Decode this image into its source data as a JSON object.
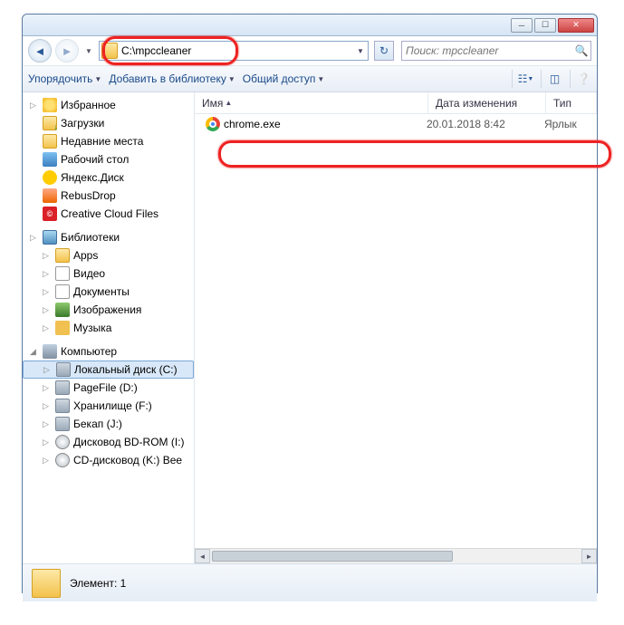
{
  "address": {
    "path": "C:\\mpccleaner"
  },
  "search": {
    "placeholder": "Поиск: mpccleaner"
  },
  "toolbar": {
    "organize": "Упорядочить",
    "add_library": "Добавить в библиотеку",
    "share": "Общий доступ"
  },
  "columns": {
    "name": "Имя",
    "date": "Дата изменения",
    "type": "Тип"
  },
  "sidebar": {
    "favorites": "Избранное",
    "items_fav": [
      "Загрузки",
      "Недавние места",
      "Рабочий стол",
      "Яндекс.Диск",
      "RebusDrop",
      "Creative Cloud Files"
    ],
    "libraries": "Библиотеки",
    "items_lib": [
      "Apps",
      "Видео",
      "Документы",
      "Изображения",
      "Музыка"
    ],
    "computer": "Компьютер",
    "items_comp": [
      "Локальный диск (C:)",
      "PageFile (D:)",
      "Хранилище (F:)",
      "Бекап (J:)",
      "Дисковод BD-ROM (I:)",
      "CD-дисковод (K:) Bee"
    ]
  },
  "files": [
    {
      "name": "chrome.exe",
      "date": "20.01.2018 8:42",
      "type": "Ярлык"
    }
  ],
  "status": {
    "label": "Элемент: 1"
  }
}
